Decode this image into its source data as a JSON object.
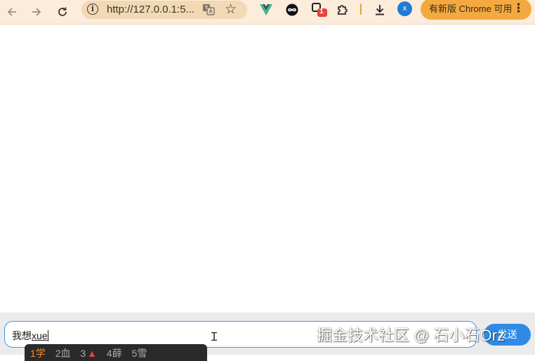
{
  "browser": {
    "url": "http://127.0.0.1:5...",
    "extension_badge": "1",
    "avatar_letter": "x",
    "update_button_label": "有新版 Chrome 可用",
    "update_menu_glyph": "⋮"
  },
  "chat": {
    "input_prefix": "我想",
    "input_composition": "xue",
    "send_label": "发送"
  },
  "ime": {
    "candidates": [
      "1学",
      "2血",
      "3",
      "4薛",
      "5雪"
    ]
  },
  "watermark": "掘金技术社区 @ 石小石Orz",
  "colors": {
    "toolbar_bg": "#fbecdc",
    "omnibox_bg": "#f2d8b3",
    "update_button": "#f3a940",
    "send_button": "#2f8ae6",
    "input_border": "#3d97e6"
  }
}
